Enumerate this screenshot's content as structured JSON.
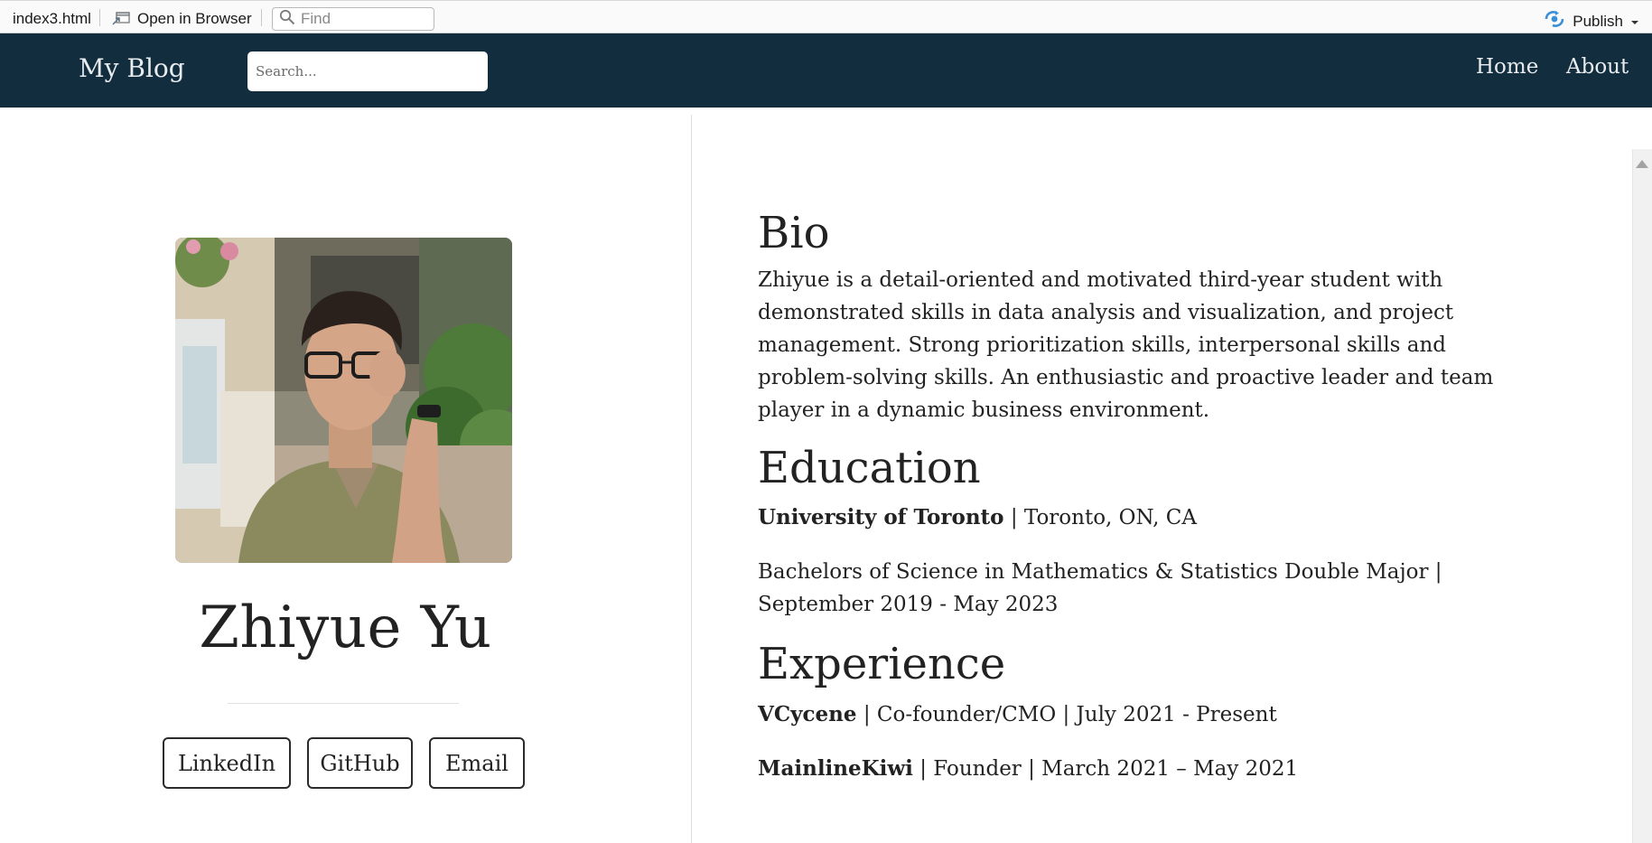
{
  "viewer": {
    "filename": "index3.html",
    "open_in_browser": "Open in Browser",
    "find_placeholder": "Find",
    "publish": "Publish"
  },
  "navbar": {
    "brand": "My Blog",
    "search_placeholder": "Search...",
    "links": [
      {
        "label": "Home"
      },
      {
        "label": "About"
      }
    ]
  },
  "profile": {
    "name": "Zhiyue Yu",
    "buttons": [
      {
        "label": "LinkedIn"
      },
      {
        "label": "GitHub"
      },
      {
        "label": "Email"
      }
    ]
  },
  "bio": {
    "title": "Bio",
    "text": "Zhiyue is a detail-oriented and motivated third-year student with demonstrated skills in data analysis and visualization, and project management. Strong prioritization skills, interpersonal skills and problem-solving skills. An enthusiastic and proactive leader and team player in a dynamic business environment."
  },
  "education": {
    "title": "Education",
    "school": "University of Toronto",
    "location": " | Toronto, ON, CA",
    "degree": "Bachelors of Science in Mathematics & Statistics Double Major | September 2019 - May 2023"
  },
  "experience": {
    "title": "Experience",
    "items": [
      {
        "org": "VCycene",
        "detail": " | Co-founder/CMO | July 2021 - Present"
      },
      {
        "org": "MainlineKiwi",
        "detail": " | Founder | March 2021 – May 2021"
      }
    ]
  },
  "colors": {
    "navbar_bg": "#122d3e",
    "nav_text": "#e8ecef",
    "publish_icon": "#3a8fd6"
  }
}
